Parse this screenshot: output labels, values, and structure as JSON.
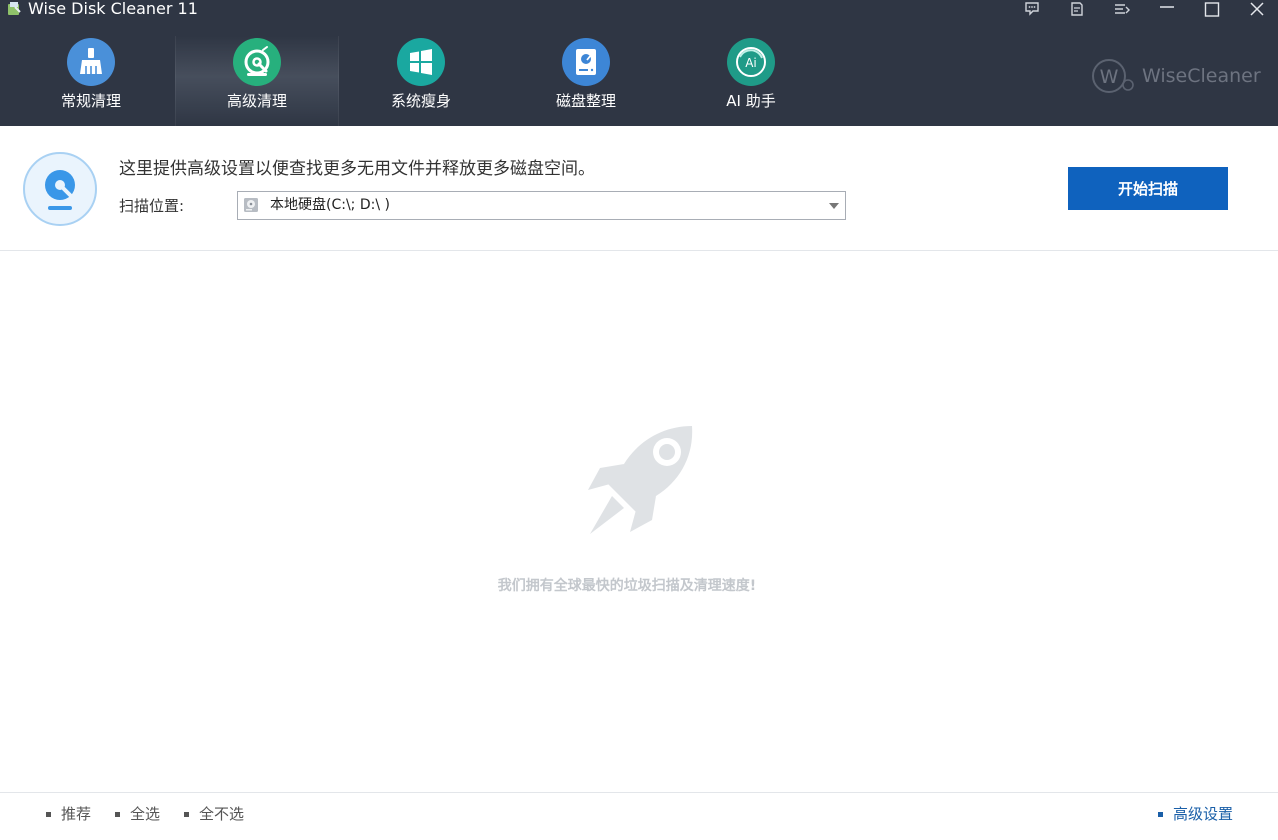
{
  "window": {
    "title": "Wise Disk Cleaner 11",
    "icons": [
      "app-icon",
      "chat-icon",
      "notes-icon",
      "menu-icon",
      "minimize-icon",
      "maximize-icon",
      "close-icon"
    ]
  },
  "nav": {
    "tabs": [
      {
        "label": "常规清理",
        "icon": "broom-icon",
        "color": "#4a90d9",
        "active": false
      },
      {
        "label": "高级清理",
        "icon": "disk-clean-icon",
        "color": "#27b07d",
        "active": true
      },
      {
        "label": "系统瘦身",
        "icon": "windows-icon",
        "color": "#1aa8a0",
        "active": false
      },
      {
        "label": "磁盘整理",
        "icon": "drive-icon",
        "color": "#3d86d6",
        "active": false
      },
      {
        "label": "AI 助手",
        "icon": "ai-icon",
        "color": "#1f9b88",
        "active": false
      }
    ]
  },
  "brand": {
    "text": "WiseCleaner"
  },
  "scan": {
    "description": "这里提供高级设置以便查找更多无用文件并释放更多磁盘空间。",
    "location_label": "扫描位置:",
    "location_value": "本地硬盘(C:\\; D:\\ )",
    "start_button": "开始扫描"
  },
  "main": {
    "slogan": "我们拥有全球最快的垃圾扫描及清理速度!"
  },
  "footer": {
    "recommend": "推荐",
    "select_all": "全选",
    "select_none": "全不选",
    "advanced": "高级设置"
  },
  "colors": {
    "header_bg": "#2f3644",
    "accent": "#0f62be",
    "link": "#1a5fa8"
  }
}
